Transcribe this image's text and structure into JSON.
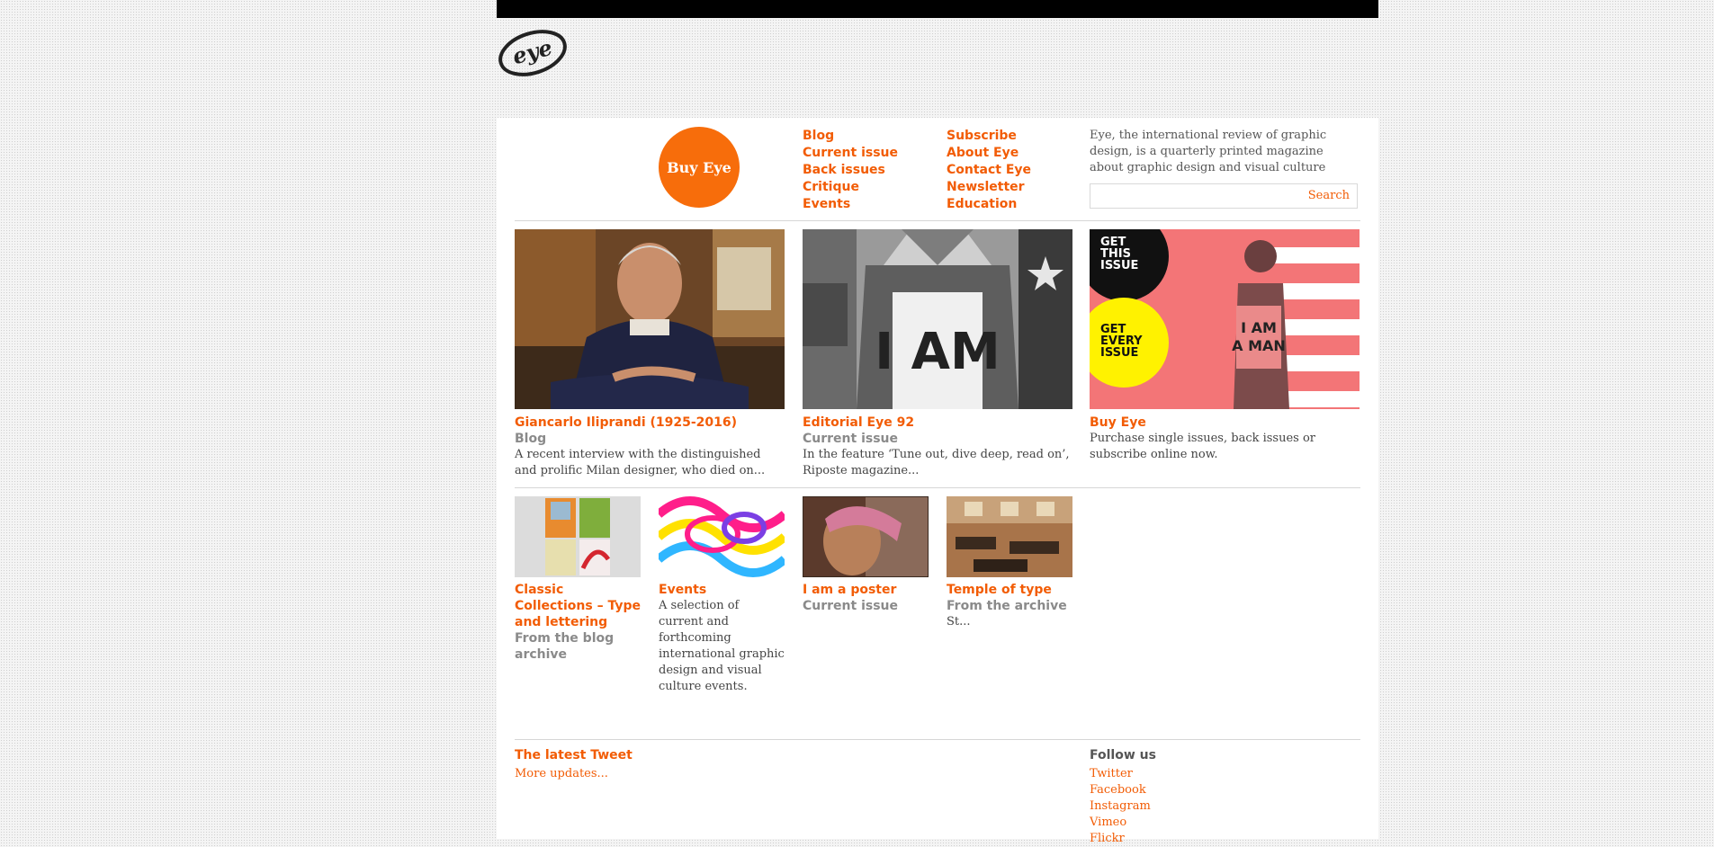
{
  "logo": {
    "text": "eye"
  },
  "buy_circle": {
    "label": "Buy Eye"
  },
  "nav": {
    "col1": [
      "Blog",
      "Current issue",
      "Back issues",
      "Critique",
      "Events"
    ],
    "col2": [
      "Subscribe",
      "About Eye",
      "Contact Eye",
      "Newsletter",
      "Education"
    ]
  },
  "intro": "Eye, the international review of graphic design, is a quarterly printed magazine about graphic design and visual culture",
  "search": {
    "value": "",
    "button": "Search"
  },
  "featured": [
    {
      "title": "Giancarlo Iliprandi (1925-2016)",
      "section": "Blog",
      "description": "A recent interview with the distinguished and prolific Milan designer, who died on..."
    },
    {
      "title": "Editorial Eye 92",
      "section": "Current issue",
      "description": "In the feature ‘Tune out, dive deep, read on’, Riposte magazine..."
    },
    {
      "title": "Buy Eye",
      "section": "",
      "description": "Purchase single issues, back issues or subscribe online now.",
      "promo": {
        "get_this_issue": "GET THIS ISSUE",
        "get_every_issue": "GET EVERY ISSUE"
      }
    }
  ],
  "secondary": [
    {
      "title": "Classic Collections – Type and lettering",
      "section": "From the blog archive",
      "description": ""
    },
    {
      "title": "Events",
      "section": "",
      "description": "A selection of current and forthcoming international graphic design and visual culture events."
    },
    {
      "title": "I am a poster",
      "section": "Current issue",
      "description": ""
    },
    {
      "title": "Temple of type",
      "section": "From the archive",
      "description": "St..."
    }
  ],
  "footer": {
    "tweet_heading": "The latest Tweet",
    "more_updates": "More updates...",
    "follow_heading": "Follow us",
    "follow_links": [
      "Twitter",
      "Facebook",
      "Instagram",
      "Vimeo",
      "Flickr"
    ]
  },
  "colors": {
    "accent": "#f25c05",
    "section_grey": "#8a8a8a",
    "top_bar": "#000000"
  }
}
